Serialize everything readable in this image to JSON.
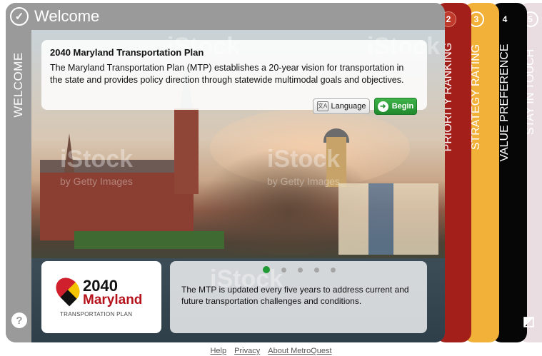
{
  "header": {
    "title": "Welcome"
  },
  "left_rail": {
    "label": "WELCOME",
    "help_symbol": "?"
  },
  "intro": {
    "title": "2040 Maryland Transportation Plan",
    "body": "The Maryland Transportation Plan (MTP) establishes a 20-year vision for transportation in the state and provides policy direction through statewide multimodal goals and objectives.",
    "language_label": "Language",
    "begin_label": "Begin"
  },
  "logo": {
    "year": "2040",
    "state": "Maryland",
    "subtitle": "TRANSPORTATION PLAN"
  },
  "carousel": {
    "text": "The MTP is updated every five years to address current and future transportation challenges and conditions.",
    "active_index": 0,
    "count": 5
  },
  "watermark": {
    "brand": "iStock",
    "sub": "by Getty Images"
  },
  "tabs": [
    {
      "number": "2",
      "label": "PRIORITY RANKING",
      "color": "#a31f1a"
    },
    {
      "number": "3",
      "label": "STRATEGY RATING",
      "color": "#f2b23a"
    },
    {
      "number": "4",
      "label": "VALUE PREFERENCE",
      "color": "#060606"
    },
    {
      "number": "5",
      "label": "STAY IN TOUCH",
      "color": "#e9dde1"
    }
  ],
  "footer": {
    "help": "Help",
    "privacy": "Privacy",
    "about": "About MetroQuest"
  },
  "colors": {
    "accent_green": "#1f9a34",
    "frame_gray": "#9a9a9a",
    "maryland_red": "#b5121b"
  }
}
